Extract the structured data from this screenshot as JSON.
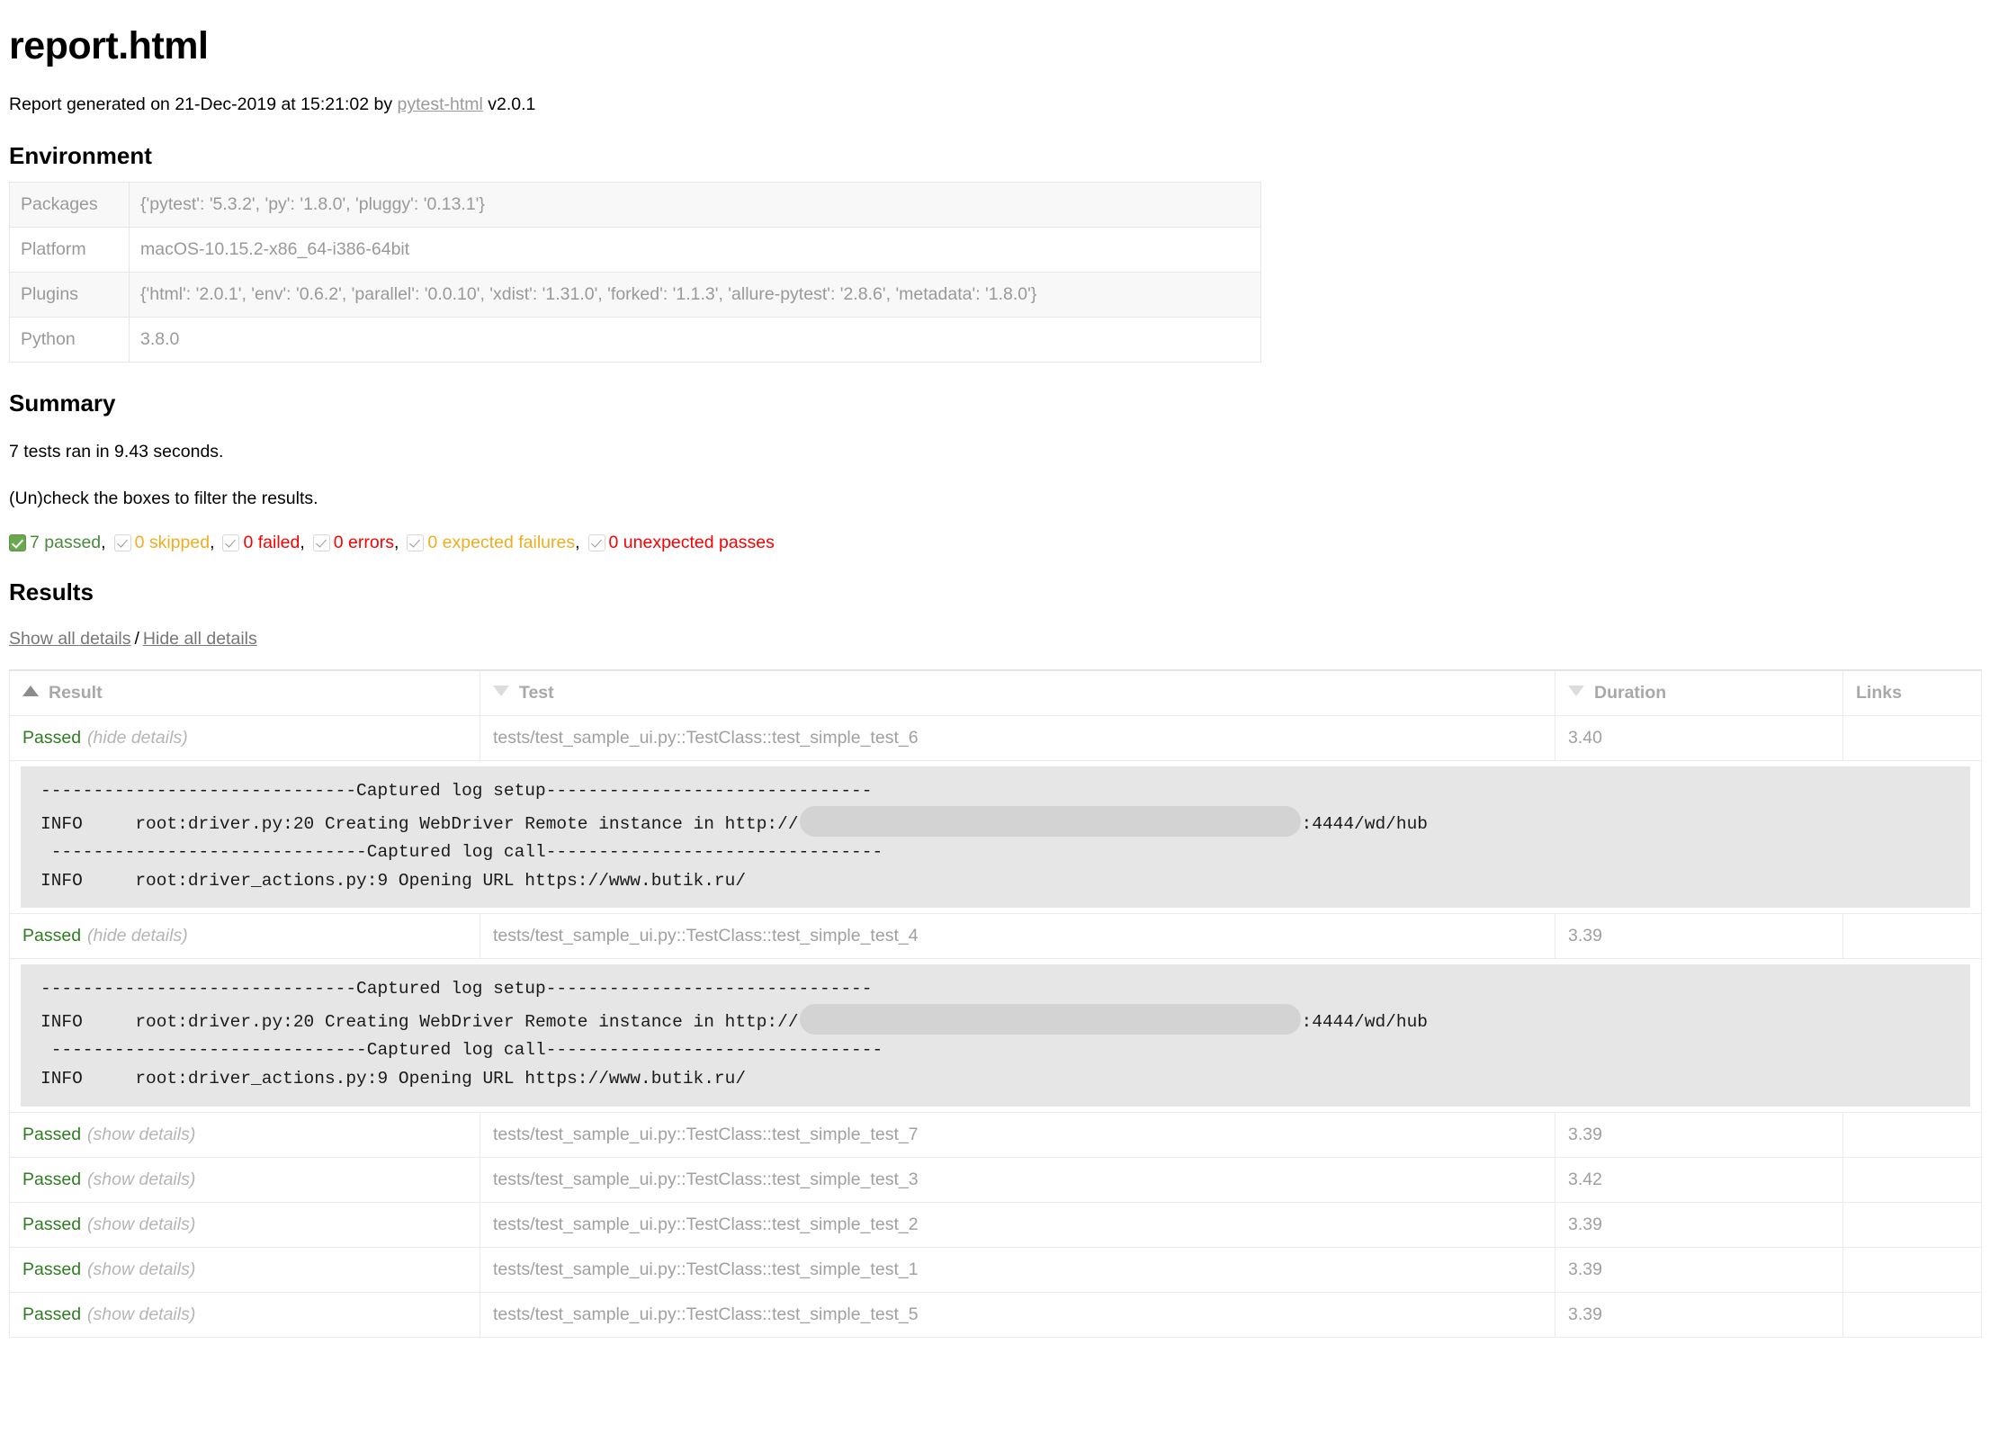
{
  "document": {
    "title": "report.html",
    "generated_prefix": "Report generated on ",
    "generated_datetime": "21-Dec-2019 at 15:21:02",
    "generated_by": " by ",
    "generator_link": "pytest-html",
    "generator_version": " v2.0.1"
  },
  "environment": {
    "heading": "Environment",
    "rows": [
      {
        "key": "Packages",
        "value": "{'pytest': '5.3.2', 'py': '1.8.0', 'pluggy': '0.13.1'}"
      },
      {
        "key": "Platform",
        "value": "macOS-10.15.2-x86_64-i386-64bit"
      },
      {
        "key": "Plugins",
        "value": "{'html': '2.0.1', 'env': '0.6.2', 'parallel': '0.0.10', 'xdist': '1.31.0', 'forked': '1.1.3', 'allure-pytest': '2.8.6', 'metadata': '1.8.0'}"
      },
      {
        "key": "Python",
        "value": "3.8.0"
      }
    ]
  },
  "summary": {
    "heading": "Summary",
    "run_line": "7 tests ran in 9.43 seconds.",
    "filter_hint": "(Un)check the boxes to filter the results.",
    "filters": [
      {
        "label": "7 passed",
        "checked": true,
        "color_class": "c-passed",
        "trailing": ","
      },
      {
        "label": "0 skipped",
        "checked": false,
        "color_class": "c-skipped",
        "trailing": ","
      },
      {
        "label": "0 failed",
        "checked": false,
        "color_class": "c-failed",
        "trailing": ","
      },
      {
        "label": "0 errors",
        "checked": false,
        "color_class": "c-errors",
        "trailing": ","
      },
      {
        "label": "0 expected failures",
        "checked": false,
        "color_class": "c-xfail",
        "trailing": ","
      },
      {
        "label": "0 unexpected passes",
        "checked": false,
        "color_class": "c-xpass",
        "trailing": ""
      }
    ]
  },
  "results": {
    "heading": "Results",
    "show_all": "Show all details",
    "separator": "/",
    "hide_all": "Hide all details",
    "columns": [
      {
        "label": "Result",
        "sort": "asc"
      },
      {
        "label": "Test",
        "sort": "desc"
      },
      {
        "label": "Duration",
        "sort": "desc"
      },
      {
        "label": "Links",
        "sort": "none"
      }
    ],
    "rows": [
      {
        "result": "Passed",
        "toggle": "(hide details)",
        "test": "tests/test_sample_ui.py::TestClass::test_simple_test_6",
        "duration": "3.40",
        "links": "",
        "expanded": true
      },
      {
        "result": "Passed",
        "toggle": "(hide details)",
        "test": "tests/test_sample_ui.py::TestClass::test_simple_test_4",
        "duration": "3.39",
        "links": "",
        "expanded": true
      },
      {
        "result": "Passed",
        "toggle": "(show details)",
        "test": "tests/test_sample_ui.py::TestClass::test_simple_test_7",
        "duration": "3.39",
        "links": "",
        "expanded": false
      },
      {
        "result": "Passed",
        "toggle": "(show details)",
        "test": "tests/test_sample_ui.py::TestClass::test_simple_test_3",
        "duration": "3.42",
        "links": "",
        "expanded": false
      },
      {
        "result": "Passed",
        "toggle": "(show details)",
        "test": "tests/test_sample_ui.py::TestClass::test_simple_test_2",
        "duration": "3.39",
        "links": "",
        "expanded": false
      },
      {
        "result": "Passed",
        "toggle": "(show details)",
        "test": "tests/test_sample_ui.py::TestClass::test_simple_test_1",
        "duration": "3.39",
        "links": "",
        "expanded": false
      },
      {
        "result": "Passed",
        "toggle": "(show details)",
        "test": "tests/test_sample_ui.py::TestClass::test_simple_test_5",
        "duration": "3.39",
        "links": "",
        "expanded": false
      }
    ],
    "log": {
      "setup_banner": "------------------------------Captured log setup-------------------------------",
      "setup_line_prefix": "INFO     root:driver.py:20 Creating WebDriver Remote instance in http://",
      "setup_line_suffix": ":4444/wd/hub",
      "redacted": true,
      "call_banner": " ------------------------------Captured log call--------------------------------",
      "call_line": "INFO     root:driver_actions.py:9 Opening URL https://www.butik.ru/"
    }
  }
}
